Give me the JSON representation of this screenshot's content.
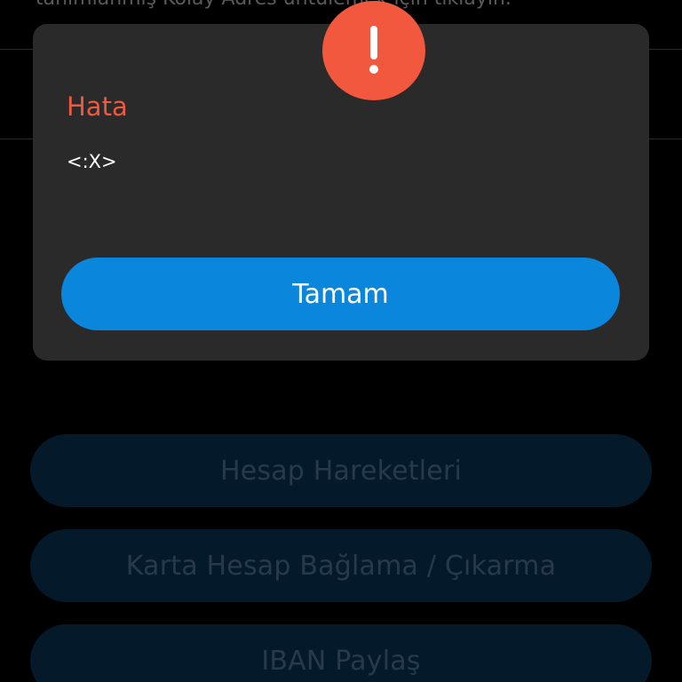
{
  "background": {
    "top_text": "tanımlanmış Kolay Adres       üntülemek için tıklayın.",
    "buttons": [
      {
        "label": "Hesap Hareketleri"
      },
      {
        "label": "Karta Hesap Bağlama / Çıkarma"
      },
      {
        "label": "IBAN Paylaş"
      }
    ]
  },
  "dialog": {
    "icon": "exclamation-icon",
    "title": "Hata",
    "message": "<:X>",
    "ok_label": "Tamam"
  },
  "colors": {
    "error_accent": "#f2583e",
    "primary_button": "#0a86dc",
    "dialog_background": "#2a2a2a"
  }
}
